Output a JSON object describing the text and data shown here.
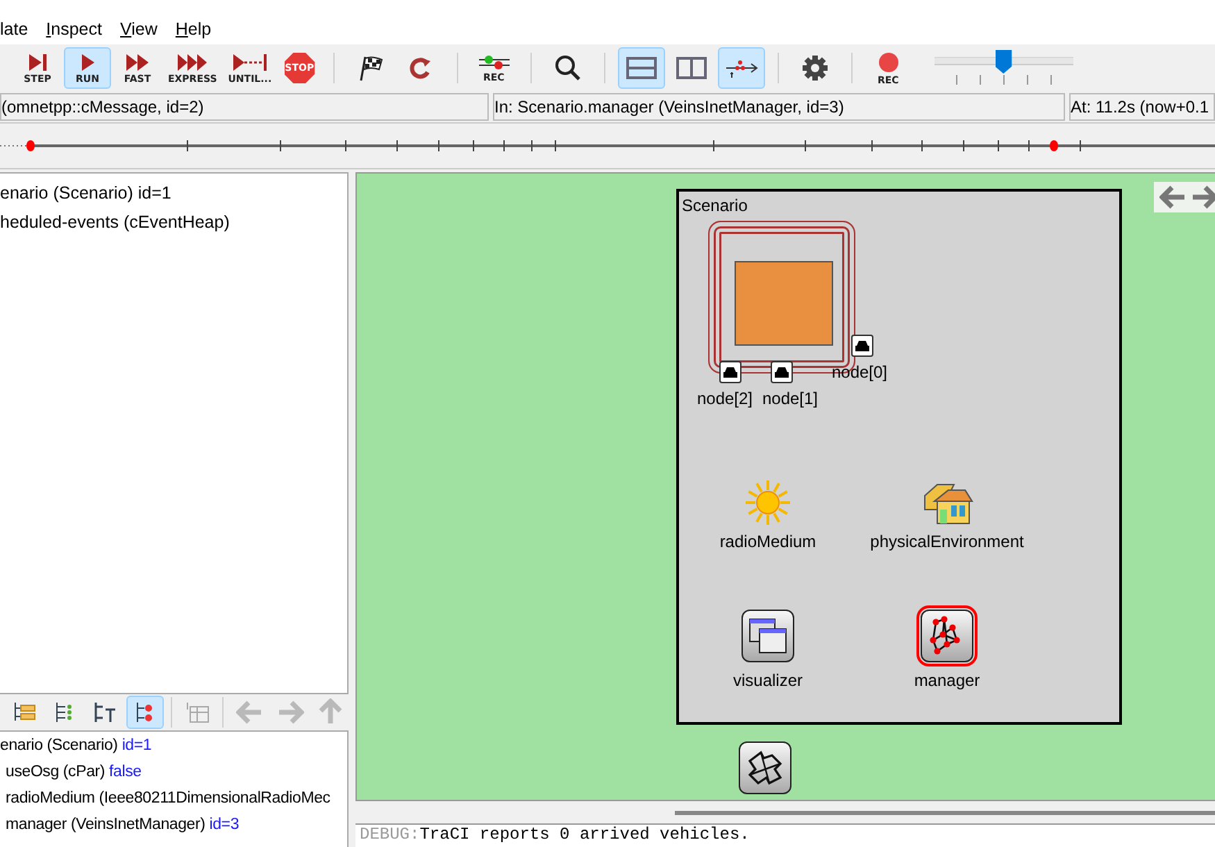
{
  "menu": [
    {
      "label": "late",
      "mnemonic": false
    },
    {
      "label": "Inspect",
      "mnemonic": true
    },
    {
      "label": "View",
      "mnemonic": true
    },
    {
      "label": "Help",
      "mnemonic": true
    }
  ],
  "toolbar": {
    "groups": [
      [
        {
          "kind": "step",
          "label": "STEP",
          "selected": false
        },
        {
          "kind": "run",
          "label": "RUN",
          "selected": true
        },
        {
          "kind": "fast",
          "label": "FAST",
          "selected": false
        },
        {
          "kind": "express",
          "label": "EXPRESS",
          "selected": false
        },
        {
          "kind": "until",
          "label": "UNTIL...",
          "selected": false
        },
        {
          "kind": "stop",
          "label": "STOP",
          "selected": false
        }
      ],
      [
        {
          "kind": "flag",
          "selected": false
        },
        {
          "kind": "rebuild",
          "selected": false
        }
      ],
      [
        {
          "kind": "record-lights",
          "label": "REC",
          "selected": false
        }
      ],
      [
        {
          "kind": "search",
          "selected": false
        }
      ],
      [
        {
          "kind": "split-rows",
          "selected": true
        },
        {
          "kind": "split-columns",
          "selected": false
        },
        {
          "kind": "timeline",
          "selected": true
        }
      ],
      [
        {
          "kind": "gear",
          "selected": false
        }
      ],
      [
        {
          "kind": "record",
          "label": "REC",
          "selected": false
        }
      ]
    ],
    "speed_slider": {
      "level": 0.5
    }
  },
  "status_bar": [
    "(omnetpp::cMessage, id=2)",
    "In: Scenario.manager (VeinsInetManager, id=3)",
    "At: 11.2s (now+0.1"
  ],
  "object_tree": [
    "enario (Scenario) id=1",
    "heduled-events (cEventHeap)"
  ],
  "inspector_toolbar": [
    {
      "kind": "tree",
      "selected": false,
      "disabled": false
    },
    {
      "kind": "list",
      "selected": false,
      "disabled": false
    },
    {
      "kind": "text-list",
      "selected": false,
      "disabled": false
    },
    {
      "kind": "flat",
      "selected": true,
      "disabled": false
    },
    {
      "kind": "table",
      "selected": false,
      "disabled": true
    },
    {
      "kind": "back",
      "selected": false,
      "disabled": true
    },
    {
      "kind": "forward",
      "selected": false,
      "disabled": true
    },
    {
      "kind": "up",
      "selected": false,
      "disabled": true
    }
  ],
  "inspector": [
    {
      "text": "enario (Scenario)",
      "value": "id=1",
      "children": [
        {
          "text": "useOsg (cPar)",
          "value": "false"
        },
        {
          "text": "radioMedium (Ieee80211DimensionalRadioMec"
        },
        {
          "text": "manager (VeinsInetManager)",
          "value": "id=3"
        }
      ]
    }
  ],
  "network": {
    "title": "Scenario",
    "nodes": [
      "node[0]",
      "node[1]",
      "node[2]"
    ],
    "submodules": [
      {
        "kind": "radio",
        "label": "radioMedium",
        "selected": false
      },
      {
        "kind": "environment",
        "label": "physicalEnvironment",
        "selected": false
      },
      {
        "kind": "visualizer",
        "label": "visualizer",
        "selected": false
      },
      {
        "kind": "manager",
        "label": "manager",
        "selected": true
      }
    ],
    "outside": [
      {
        "kind": "puzzle",
        "selected": false
      }
    ]
  },
  "log": [
    {
      "level": "DEBUG:",
      "text": "TraCI reports 0 arrived vehicles."
    }
  ]
}
